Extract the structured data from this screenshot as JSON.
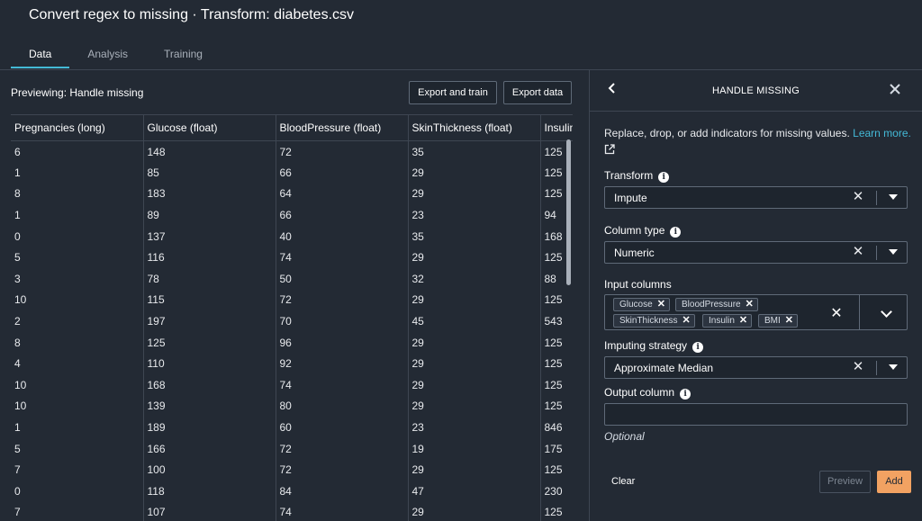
{
  "window": {
    "title": "Convert regex to missing · Transform: diabetes.csv"
  },
  "tabs": [
    {
      "label": "Data",
      "active": true
    },
    {
      "label": "Analysis",
      "active": false
    },
    {
      "label": "Training",
      "active": false
    }
  ],
  "preview": {
    "label": "Previewing: Handle missing",
    "export_train_label": "Export and train",
    "export_data_label": "Export data"
  },
  "table": {
    "columns": [
      "Pregnancies (long)",
      "Glucose (float)",
      "BloodPressure (float)",
      "SkinThickness (float)",
      "Insulin (float)"
    ],
    "rows": [
      [
        "6",
        "148",
        "72",
        "35",
        "125"
      ],
      [
        "1",
        "85",
        "66",
        "29",
        "125"
      ],
      [
        "8",
        "183",
        "64",
        "29",
        "125"
      ],
      [
        "1",
        "89",
        "66",
        "23",
        "94"
      ],
      [
        "0",
        "137",
        "40",
        "35",
        "168"
      ],
      [
        "5",
        "116",
        "74",
        "29",
        "125"
      ],
      [
        "3",
        "78",
        "50",
        "32",
        "88"
      ],
      [
        "10",
        "115",
        "72",
        "29",
        "125"
      ],
      [
        "2",
        "197",
        "70",
        "45",
        "543"
      ],
      [
        "8",
        "125",
        "96",
        "29",
        "125"
      ],
      [
        "4",
        "110",
        "92",
        "29",
        "125"
      ],
      [
        "10",
        "168",
        "74",
        "29",
        "125"
      ],
      [
        "10",
        "139",
        "80",
        "29",
        "125"
      ],
      [
        "1",
        "189",
        "60",
        "23",
        "846"
      ],
      [
        "5",
        "166",
        "72",
        "19",
        "175"
      ],
      [
        "7",
        "100",
        "72",
        "29",
        "125"
      ],
      [
        "0",
        "118",
        "84",
        "47",
        "230"
      ],
      [
        "7",
        "107",
        "74",
        "29",
        "125"
      ]
    ]
  },
  "panel": {
    "title": "HANDLE MISSING",
    "description": "Replace, drop, or add indicators for missing values.",
    "learn_more": "Learn more.",
    "transform": {
      "label": "Transform",
      "value": "Impute"
    },
    "column_type": {
      "label": "Column type",
      "value": "Numeric"
    },
    "input_columns": {
      "label": "Input columns",
      "tokens": [
        "Glucose",
        "BloodPressure",
        "SkinThickness",
        "Insulin",
        "BMI"
      ]
    },
    "imputing_strategy": {
      "label": "Imputing strategy",
      "value": "Approximate Median"
    },
    "output_column": {
      "label": "Output column",
      "value": "",
      "hint": "Optional"
    },
    "clear_label": "Clear",
    "preview_label": "Preview",
    "add_label": "Add"
  },
  "icons": {
    "back": "chevron-left-icon",
    "close": "close-icon",
    "info": "info-icon",
    "external": "external-link-icon",
    "dropdown": "caret-down-icon"
  },
  "colors": {
    "background": "#232a34",
    "accent": "#44b9d6",
    "primary_button": "#f2a262"
  }
}
